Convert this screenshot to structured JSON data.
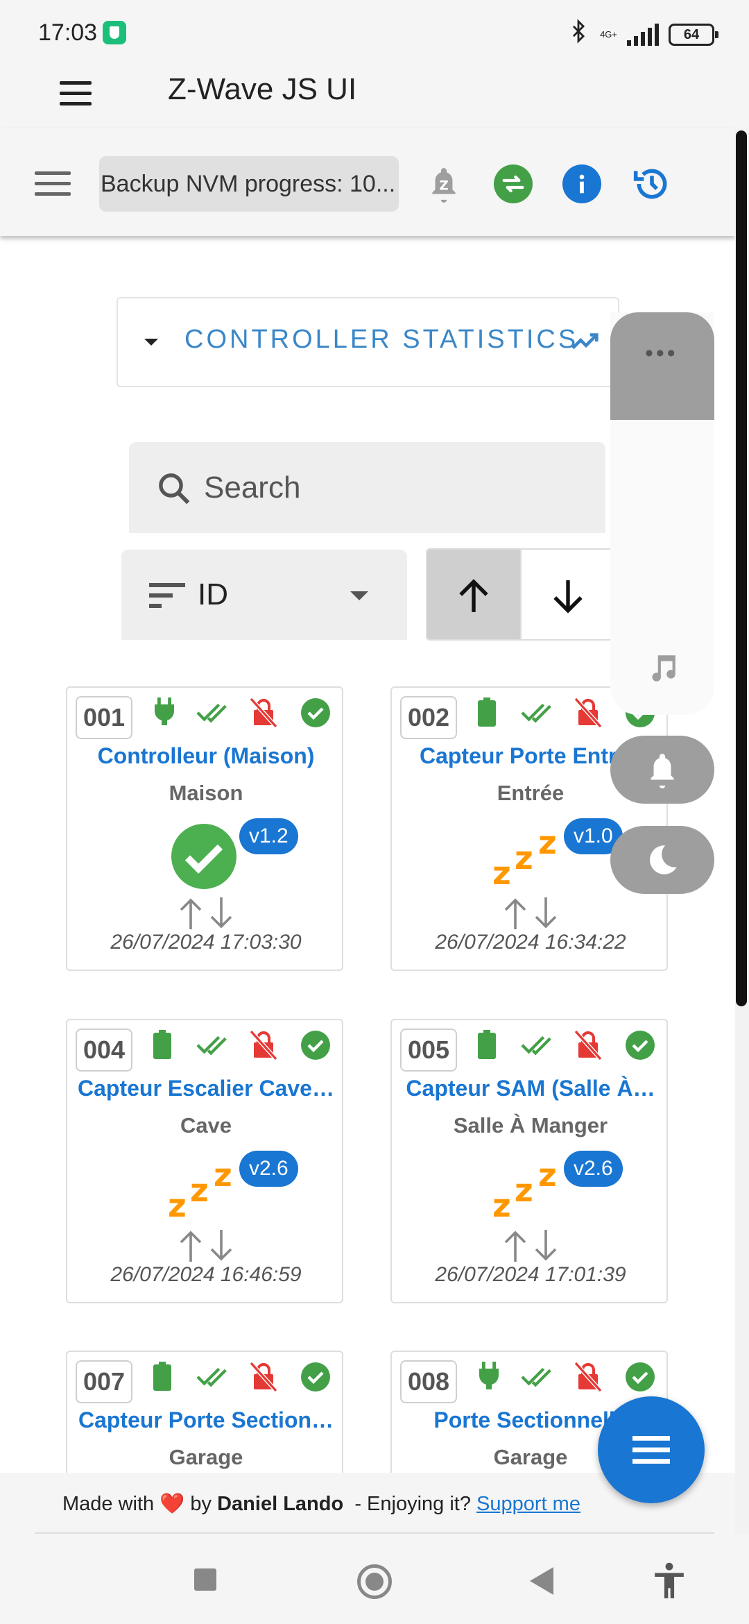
{
  "status_bar": {
    "time": "17:03",
    "network": "4G+",
    "battery": "64"
  },
  "app": {
    "title": "Z-Wave JS UI"
  },
  "toolbar": {
    "progress_text": "Backup NVM progress: 10...",
    "colors": {
      "green": "#43a047",
      "blue": "#1976d2"
    }
  },
  "controller_stats": {
    "label": "CONTROLLER STATISTICS"
  },
  "search": {
    "placeholder": "Search"
  },
  "sort": {
    "value": "ID"
  },
  "nodes": [
    {
      "id": "001",
      "name": "Controlleur (Maison)",
      "location": "Maison",
      "version": "v1.2",
      "power": "mains",
      "state": "ready",
      "timestamp": "26/07/2024 17:03:30"
    },
    {
      "id": "002",
      "name": "Capteur Porte Entrée",
      "location": "Entrée",
      "version": "v1.0",
      "power": "battery",
      "state": "asleep",
      "timestamp": "26/07/2024 16:34:22"
    },
    {
      "id": "004",
      "name": "Capteur Escalier Cave…",
      "location": "Cave",
      "version": "v2.6",
      "power": "battery",
      "state": "asleep",
      "timestamp": "26/07/2024 16:46:59"
    },
    {
      "id": "005",
      "name": "Capteur SAM (Salle À…",
      "location": "Salle À Manger",
      "version": "v2.6",
      "power": "battery",
      "state": "asleep",
      "timestamp": "26/07/2024 17:01:39"
    },
    {
      "id": "007",
      "name": "Capteur Porte Section…",
      "location": "Garage",
      "version": "",
      "power": "battery",
      "state": "",
      "timestamp": ""
    },
    {
      "id": "008",
      "name": "Porte Sectionnelle",
      "location": "Garage",
      "version": "",
      "power": "mains",
      "state": "",
      "timestamp": ""
    }
  ],
  "footer": {
    "made_with": "Made with",
    "by": "by",
    "author": "Daniel Lando",
    "enjoying": "- Enjoying it?",
    "support": "Support me"
  }
}
